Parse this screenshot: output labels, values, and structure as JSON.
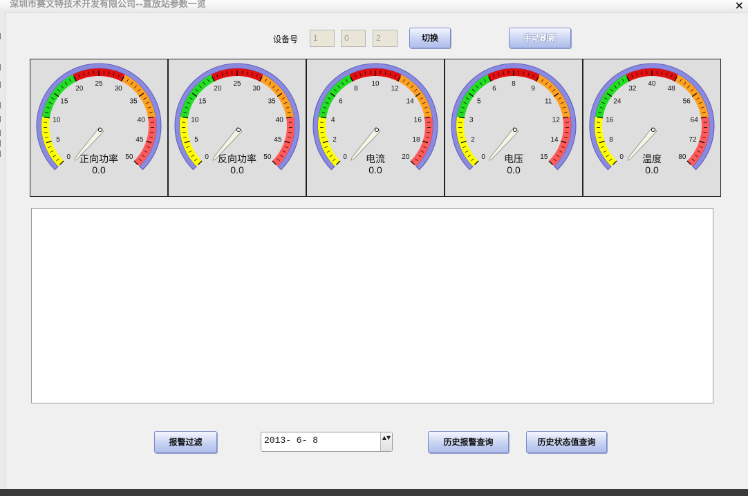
{
  "window": {
    "title": "深圳市赛文特技术开发有限公司--直放站参数一览",
    "close_glyph": "×"
  },
  "device": {
    "label": "设备号",
    "fields": [
      "1",
      "0",
      "2"
    ],
    "switch_label": "切换",
    "refresh_label": "手动刷新"
  },
  "gauges": [
    {
      "name": "正向功率",
      "value": "0.0",
      "max": 50,
      "ticks": [
        "0",
        "5",
        "10",
        "15",
        "20",
        "25",
        "30",
        "35",
        "40",
        "45",
        "50"
      ]
    },
    {
      "name": "反向功率",
      "value": "0.0",
      "max": 50,
      "ticks": [
        "0",
        "5",
        "10",
        "15",
        "20",
        "25",
        "30",
        "35",
        "40",
        "45",
        "50"
      ]
    },
    {
      "name": "电流",
      "value": "0.0",
      "max": 20,
      "ticks": [
        "0",
        "2",
        "4",
        "6",
        "8",
        "10",
        "12",
        "14",
        "16",
        "18",
        "20"
      ]
    },
    {
      "name": "电压",
      "value": "0.0",
      "max": 15,
      "ticks": [
        "0",
        "2",
        "3",
        "5",
        "6",
        "8",
        "9",
        "11",
        "12",
        "14",
        "15"
      ]
    },
    {
      "name": "温度",
      "value": "0.0",
      "max": 80,
      "ticks": [
        "0",
        "8",
        "16",
        "24",
        "32",
        "40",
        "48",
        "56",
        "64",
        "72",
        "80"
      ]
    }
  ],
  "gauge_colors": {
    "yellow": "#ffff00",
    "green": "#22dd22",
    "red": "#e01010",
    "orange": "#ffa020",
    "light_red": "#ff5a5a",
    "rim": "#8a8ae0"
  },
  "bottom": {
    "alarm_filter_label": "报警过滤",
    "date_value": "2013- 6- 8",
    "date_spin_glyph": "▲▼",
    "history_alarm_label": "历史报警查询",
    "history_status_label": "历史状态值查询"
  }
}
